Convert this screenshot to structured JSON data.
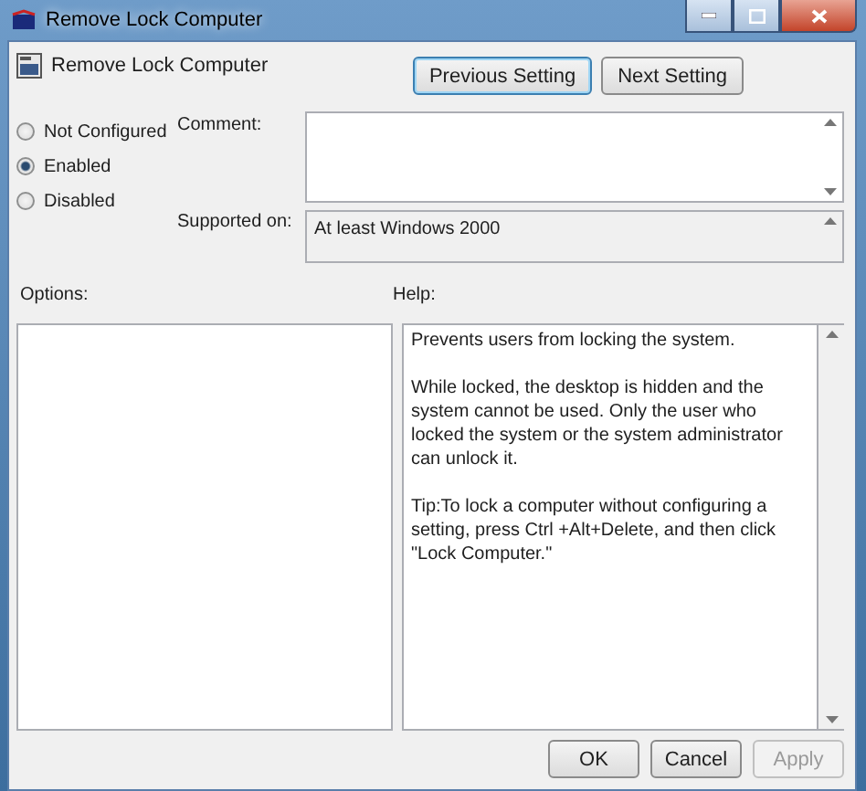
{
  "window": {
    "title": "Remove Lock Computer"
  },
  "header": {
    "title": "Remove Lock Computer",
    "buttons": [
      {
        "label": "Previous Setting",
        "focused": true
      },
      {
        "label": "Next Setting",
        "focused": false
      }
    ]
  },
  "states": [
    {
      "label": "Not Configured",
      "selected": false
    },
    {
      "label": "Enabled",
      "selected": true
    },
    {
      "label": "Disabled",
      "selected": false
    }
  ],
  "comment": {
    "label": "Comment:"
  },
  "supported": {
    "label": "Supported on:",
    "value": "At least Windows 2000"
  },
  "options": {
    "label": "Options:"
  },
  "help": {
    "label": "Help:",
    "paragraphs": [
      "Prevents users from locking the system.",
      "While locked, the desktop is hidden and the system cannot be used. Only the user who locked the system or the system administrator can unlock it.",
      "Tip:To lock a computer without configuring a setting, press Ctrl +Alt+Delete, and then click \"Lock Computer.\""
    ]
  },
  "buttons": [
    {
      "label": "OK",
      "disabled": false
    },
    {
      "label": "Cancel",
      "disabled": false
    },
    {
      "label": "Apply",
      "disabled": true
    }
  ]
}
